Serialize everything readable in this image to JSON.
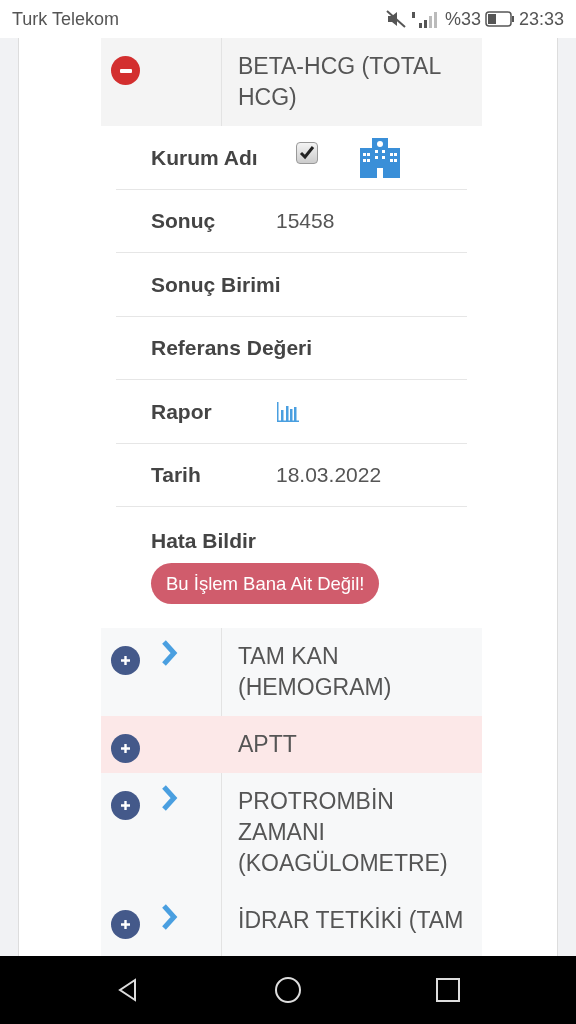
{
  "status_bar": {
    "carrier": "Turk Telekom",
    "battery_text": "%33",
    "time": "23:33"
  },
  "tests": [
    {
      "name": "BETA-HCG (TOTAL HCG)",
      "expanded": true,
      "chevron": false,
      "highlighted": false,
      "details": [
        {
          "kind": "checkbox",
          "label": "Kurum Adı",
          "checked": true
        },
        {
          "kind": "text",
          "label": "Sonuç",
          "value": "15458"
        },
        {
          "kind": "text",
          "label": "Sonuç Birimi"
        },
        {
          "kind": "text",
          "label": "Referans Değeri"
        },
        {
          "kind": "chart",
          "label": "Rapor"
        },
        {
          "kind": "text",
          "label": "Tarih",
          "value": "18.03.2022"
        },
        {
          "kind": "button",
          "label": "Hata Bildir",
          "button": "Bu İşlem Bana Ait Değil!"
        }
      ]
    },
    {
      "name": "TAM KAN (HEMOGRAM)",
      "expanded": false,
      "chevron": true,
      "highlighted": false
    },
    {
      "name": "APTT",
      "expanded": false,
      "chevron": false,
      "highlighted": true
    },
    {
      "name": "PROTROMBİN ZAMANI (KOAGÜLOMETRE)",
      "expanded": false,
      "chevron": true,
      "highlighted": false
    },
    {
      "name": "İDRAR TETKİKİ (TAM",
      "expanded": false,
      "chevron": true,
      "highlighted": false
    }
  ]
}
